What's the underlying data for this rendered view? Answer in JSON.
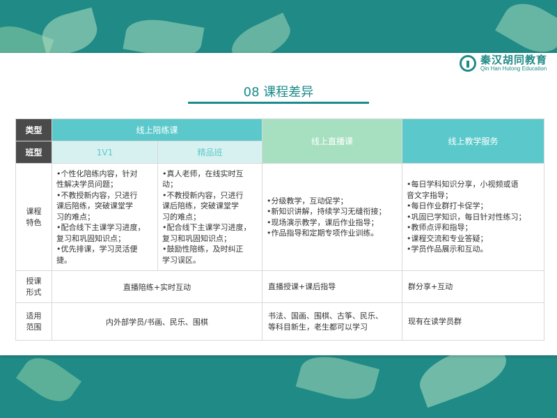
{
  "brand": {
    "name_cn": "秦汉胡同教育",
    "name_en": "Qin Han Hutong Education"
  },
  "title": "08 课程差异",
  "table": {
    "label_type": "类型",
    "label_class": "班型",
    "online_accompany": "线上陪练课",
    "online_live": "线上直播课",
    "online_service": "线上教学服务",
    "class_1v1": "1V1",
    "class_premium": "精品班",
    "label_features": [
      "课程",
      "特色"
    ],
    "label_format": [
      "授课",
      "形式"
    ],
    "label_scope": [
      "适用",
      "范围"
    ],
    "features_1v1": [
      "•个性化陪练内容，针对",
      "性解决学员问题；",
      "•不教授新内容，只进行",
      "课后陪练，突破课堂学",
      "习的难点；",
      "•配合线下主课学习进度，",
      "复习和巩固知识点；",
      "•优先排课，学习灵活便",
      "捷。"
    ],
    "features_premium": [
      "•真人老师，在线实时互",
      "动；",
      "•不教授新内容，只进行",
      "课后陪练，突破课堂学",
      "习的难点；",
      "•配合线下主课学习进度，",
      "复习和巩固知识点；",
      "•鼓励性陪练，及时纠正",
      "学习误区。"
    ],
    "features_live": [
      "•分级教学，互动促学；",
      "•新知识讲解，持续学习无缝衔接；",
      "•现场演示教学，课后作业指导；",
      "•作品指导和定期专项作业训练。"
    ],
    "features_service": [
      "•每日学科知识分享，小视频或语",
      "音文字指导；",
      "•每日作业群打卡促学；",
      "•巩固已学知识，每日针对性练习；",
      "•教师点评和指导；",
      "•课程交流和专业答疑；",
      "•学员作品展示和互动。"
    ],
    "format_accompany": "直播陪练+实时互动",
    "format_live": "直播授课+课后指导",
    "format_service": "群分享+互动",
    "scope_accompany": "内外部学员/书画、民乐、围棋",
    "scope_live": [
      "书法、国画、围棋、古筝、民乐、",
      "等科目新生，老生都可以学习"
    ],
    "scope_service": "现有在读学员群"
  }
}
